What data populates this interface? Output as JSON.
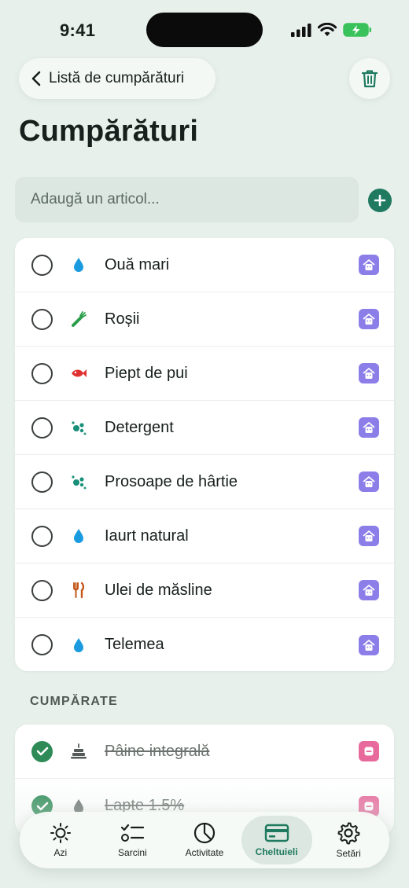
{
  "status_bar": {
    "time": "9:41"
  },
  "header": {
    "back_label": "Listă de cumpărături",
    "title": "Cumpărături"
  },
  "add_item": {
    "placeholder": "Adaugă un articol..."
  },
  "todo_items": [
    {
      "label": "Ouă mari",
      "icon": "drop-icon",
      "icon_color": "#1a9be0",
      "owner": "home-avatar-icon"
    },
    {
      "label": "Roșii",
      "icon": "carrot-icon",
      "icon_color": "#2a9d4a",
      "owner": "home-avatar-icon"
    },
    {
      "label": "Piept de pui",
      "icon": "fish-icon",
      "icon_color": "#e03131",
      "owner": "home-avatar-icon"
    },
    {
      "label": "Detergent",
      "icon": "bubbles-icon",
      "icon_color": "#17907a",
      "owner": "home-avatar-icon"
    },
    {
      "label": "Prosoape de hârtie",
      "icon": "bubbles-icon",
      "icon_color": "#17907a",
      "owner": "home-avatar-icon"
    },
    {
      "label": "Iaurt natural",
      "icon": "drop-icon",
      "icon_color": "#1a9be0",
      "owner": "home-avatar-icon"
    },
    {
      "label": "Ulei de măsline",
      "icon": "fork-knife-icon",
      "icon_color": "#c2581a",
      "owner": "home-avatar-icon"
    },
    {
      "label": "Telemea",
      "icon": "drop-icon",
      "icon_color": "#1a9be0",
      "owner": "home-avatar-icon"
    }
  ],
  "done_section": {
    "label": "CUMPĂRATE"
  },
  "done_items": [
    {
      "label": "Pâine integrală",
      "icon": "cake-icon",
      "icon_color": "#555b58",
      "owner": "pink-avatar-icon"
    },
    {
      "label": "Lapte 1.5%",
      "icon": "drop-icon",
      "icon_color": "#6b7270",
      "owner": "pink-avatar-icon"
    }
  ],
  "tabs": [
    {
      "label": "Azi",
      "icon": "sun-icon",
      "active": false
    },
    {
      "label": "Sarcini",
      "icon": "checklist-icon",
      "active": false
    },
    {
      "label": "Activitate",
      "icon": "pie-chart-icon",
      "active": false
    },
    {
      "label": "Cheltuieli",
      "icon": "card-icon",
      "active": true
    },
    {
      "label": "Setări",
      "icon": "gear-icon",
      "active": false
    }
  ],
  "colors": {
    "background": "#e8f0ec",
    "accent": "#1f7a5f",
    "checked": "#2e8b57",
    "owner_purple": "#8b7ee8",
    "owner_pink": "#e8699c"
  }
}
